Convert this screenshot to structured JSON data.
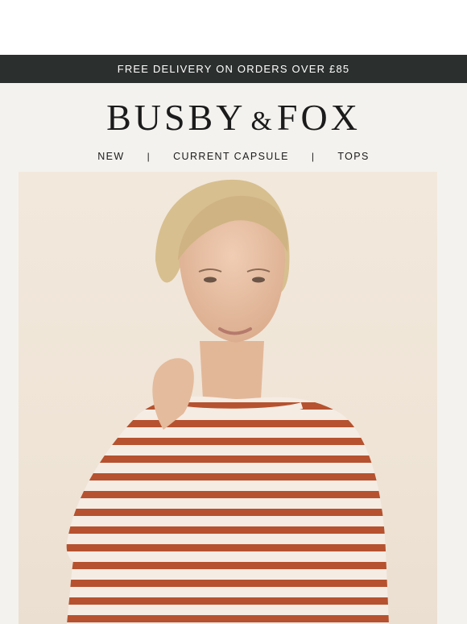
{
  "promo": {
    "text": "FREE DELIVERY ON ORDERS OVER £85"
  },
  "brand": {
    "name_left": "BUSBY",
    "ampersand": "&",
    "name_right": "FOX"
  },
  "nav": {
    "items": [
      {
        "label": "NEW"
      },
      {
        "label": "CURRENT CAPSULE"
      },
      {
        "label": "TOPS"
      }
    ],
    "separator": "|"
  },
  "colors": {
    "promo_bg": "#2b2f2e",
    "page_bg": "#f4f2ee",
    "stripe": "#b6522f",
    "sweater_base": "#f5ece4"
  }
}
